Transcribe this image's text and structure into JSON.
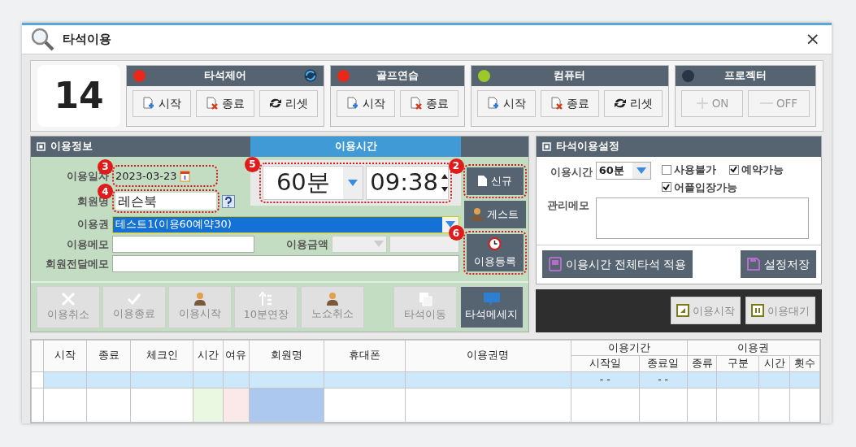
{
  "window": {
    "title": "타석이용",
    "close": "×"
  },
  "seat_number": "14",
  "control_groups": [
    {
      "title": "타석제어",
      "color": "#e8281a",
      "refresh_icon": true,
      "buttons": [
        {
          "label": "시작",
          "kind": "start",
          "disabled": false
        },
        {
          "label": "종료",
          "kind": "stop",
          "disabled": false
        },
        {
          "label": "리셋",
          "kind": "reset",
          "disabled": false
        }
      ]
    },
    {
      "title": "골프연습",
      "color": "#e8281a",
      "refresh_icon": false,
      "buttons": [
        {
          "label": "시작",
          "kind": "start",
          "disabled": false
        },
        {
          "label": "종료",
          "kind": "stop",
          "disabled": false
        }
      ]
    },
    {
      "title": "컴퓨터",
      "color": "#9cc82a",
      "refresh_icon": false,
      "buttons": [
        {
          "label": "시작",
          "kind": "start",
          "disabled": false
        },
        {
          "label": "종료",
          "kind": "stop",
          "disabled": false
        },
        {
          "label": "리셋",
          "kind": "reset",
          "disabled": false
        }
      ]
    },
    {
      "title": "프로젝터",
      "color": "#2a3446",
      "refresh_icon": false,
      "buttons": [
        {
          "label": "ON",
          "kind": "plus",
          "disabled": true
        },
        {
          "label": "OFF",
          "kind": "minus",
          "disabled": true
        }
      ]
    }
  ],
  "usage_info": {
    "title": "이용정보",
    "time_header": "이용시간",
    "date": {
      "label": "이용일자",
      "value": "2023-03-23",
      "callout": "3"
    },
    "member": {
      "label": "회원명",
      "value": "레슨북",
      "callout": "4"
    },
    "pass": {
      "label": "이용권",
      "value": "테스트1(이용60예약30)"
    },
    "memo": {
      "label": "이용메모"
    },
    "amount": {
      "label": "이용금액"
    },
    "delivery_memo": {
      "label": "회원전달메모"
    },
    "time": {
      "duration": "60분",
      "clock": "09:38",
      "callout": "5"
    },
    "side_buttons": [
      {
        "label": "신규",
        "kind": "doc",
        "callout": "2"
      },
      {
        "label": "게스트",
        "kind": "person"
      },
      {
        "label": "이용등록",
        "kind": "clock",
        "callout": "6"
      }
    ]
  },
  "action_buttons": [
    {
      "label": "이용취소",
      "kind": "cross",
      "disabled": true
    },
    {
      "label": "이용종료",
      "kind": "check",
      "disabled": true
    },
    {
      "label": "이용시작",
      "kind": "person",
      "disabled": true
    },
    {
      "label": "10분연장",
      "kind": "up",
      "disabled": true
    },
    {
      "label": "노쇼취소",
      "kind": "person",
      "disabled": true
    },
    {
      "label": "타석이동",
      "kind": "docs",
      "disabled": true
    },
    {
      "label": "타석메세지",
      "kind": "chat",
      "disabled": false
    }
  ],
  "seat_settings": {
    "title": "타석이용설정",
    "time_label": "이용시간",
    "time_value": "60분",
    "checkboxes": [
      {
        "label": "사용불가",
        "checked": false
      },
      {
        "label": "예약가능",
        "checked": true
      },
      {
        "label": "어플입장가능",
        "checked": true
      }
    ],
    "memo_label": "관리메모",
    "buttons": [
      {
        "label": "이용시간 전체타석 적용",
        "kind": "copy"
      },
      {
        "label": "설정저장",
        "kind": "save"
      }
    ]
  },
  "status_buttons": [
    {
      "label": "이용시작",
      "kind": "play",
      "disabled": true
    },
    {
      "label": "이용대기",
      "kind": "pause",
      "disabled": true
    }
  ],
  "table": {
    "columns": [
      {
        "label": "시작"
      },
      {
        "label": "종료"
      },
      {
        "label": "체크인"
      },
      {
        "label": "시간",
        "color": "#eaf8e2"
      },
      {
        "label": "여유",
        "color": "#fbe8e8"
      },
      {
        "label": "회원명",
        "color": "#acc8ee"
      },
      {
        "label": "휴대폰"
      },
      {
        "label": "이용권명"
      },
      {
        "label": "이용기간",
        "children": [
          {
            "label": "시작일"
          },
          {
            "label": "종료일"
          }
        ]
      },
      {
        "label": "이용권",
        "children": [
          {
            "label": "종류"
          },
          {
            "label": "구분"
          },
          {
            "label": "시간"
          },
          {
            "label": "횟수"
          }
        ]
      }
    ],
    "rows": [
      {
        "selected": true,
        "start_date": "- -",
        "end_date": "- -"
      },
      {
        "selected": false
      }
    ]
  }
}
